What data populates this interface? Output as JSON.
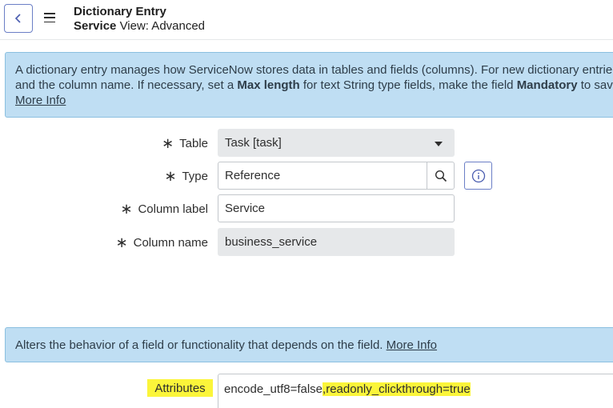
{
  "header": {
    "title": "Dictionary Entry",
    "subtitle_bold": "Service",
    "subtitle_view": "View: Advanced"
  },
  "info": {
    "line1": "A dictionary entry manages how ServiceNow stores data in tables and fields (columns). For new dictionary entrie",
    "line2_a": "and the column name. If necessary, set a ",
    "line2_b": "Max length",
    "line2_c": " for text String type fields, make the field ",
    "line2_d": "Mandatory",
    "line2_e": " to save",
    "more_info": "More Info"
  },
  "form": {
    "table": {
      "label": "Table",
      "value": "Task [task]"
    },
    "type": {
      "label": "Type",
      "value": "Reference"
    },
    "column_label": {
      "label": "Column label",
      "value": "Service"
    },
    "column_name": {
      "label": "Column name",
      "value": "business_service"
    }
  },
  "attributes_info": {
    "text": "Alters the behavior of a field or functionality that depends on the field. ",
    "more_info": "More Info"
  },
  "attributes": {
    "label": "Attributes",
    "value_plain": "encode_utf8=false",
    "value_highlighted": ",readonly_clickthrough=true"
  },
  "colors": {
    "info_bg": "#bfdef3",
    "highlight": "#fbf53a",
    "accent": "#6b7fc6"
  },
  "icons": {
    "back": "chevron-left-icon",
    "menu": "hamburger-menu-icon",
    "search": "search-icon",
    "info": "info-icon",
    "dropdown": "caret-down-icon",
    "required": "asterisk-icon"
  }
}
